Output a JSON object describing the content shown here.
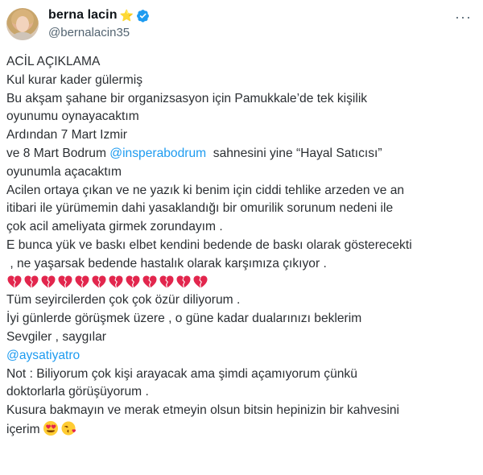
{
  "author": {
    "display_name": "berna lacin",
    "handle": "@bernalacin35",
    "star_emoji": "⭐",
    "more_glyph": "···"
  },
  "tweet": {
    "lines": [
      "ACİL AÇIKLAMA",
      "Kul kurar kader gülermiş",
      "Bu akşam şahane bir organizsasyon için Pamukkale’de tek kişilik",
      "oyunumu oynayacaktım",
      "Ardından 7 Mart Izmir"
    ],
    "line_bodrum_prefix": "ve 8 Mart Bodrum ",
    "mention_bodrum": "@insperabodrum",
    "line_bodrum_suffix": "  sahnesini yine “Hayal Satıcısı”",
    "lines_2": [
      "oyunumla açacaktım",
      "Acilen ortaya çıkan ve ne yazık ki benim için ciddi tehlike arzeden ve an",
      "itibari ile yürümemin dahi yasaklandığı bir  omurilik sorunum nedeni ile",
      "çok acil ameliyata girmek zorundayım .",
      "E bunca yük ve baskı elbet kendini bedende de baskı olarak gösterecekti",
      " , ne yaşarsak bedende hastalık olarak karşımıza çıkıyor ."
    ],
    "broken_heart_count": 12,
    "lines_3": [
      "Tüm seyircilerden çok çok özür diliyorum .",
      "İyi günlerde görüşmek üzere , o güne kadar dualarınızı beklerim",
      "Sevgiler , saygılar"
    ],
    "mention_aysati": "@aysatiyatro",
    "lines_4": [
      "Not : Biliyorum çok kişi arayacak ama şimdi açamıyorum çünkü",
      "doktorlarla görüşüyorum .",
      "Kusura bakmayın ve merak etmeyin olsun bitsin hepinizin bir kahvesini"
    ],
    "last_line": "içerim"
  },
  "colors": {
    "link": "#1d9bf0",
    "verified": "#1d9bf0",
    "heart": "#e2264d",
    "muted": "#536471"
  }
}
